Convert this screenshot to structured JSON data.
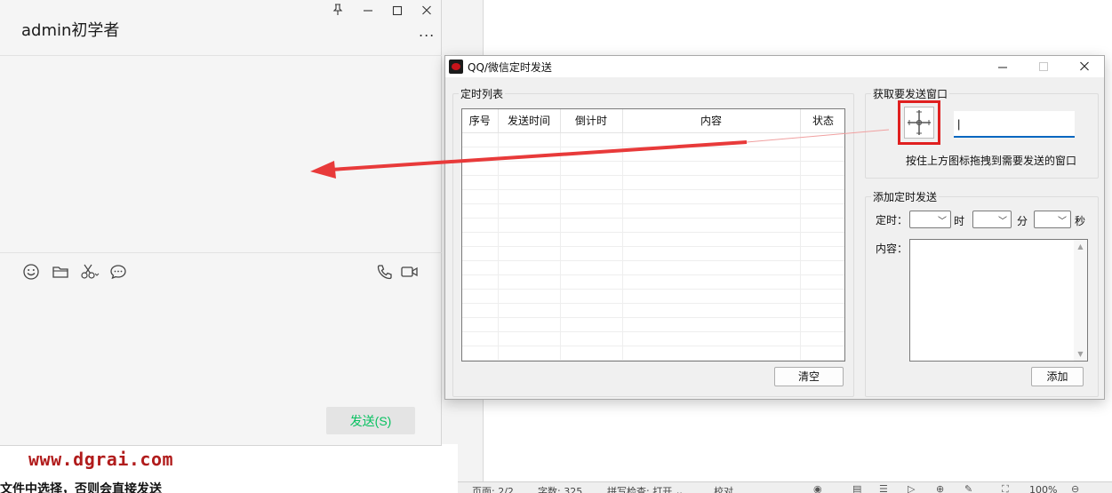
{
  "chat": {
    "title": "admin初学者",
    "more": "...",
    "send_label": "发送(S)"
  },
  "colors": {
    "wechat_green": "#07c160",
    "highlight_red": "#e02020",
    "arrow_red": "#e83a3a",
    "focus_blue": "#0067c0"
  },
  "icons": {
    "pin": "pin-icon",
    "minimize": "minimize-icon",
    "maximize": "maximize-icon",
    "close": "close-icon",
    "chat_tools": [
      "emoji-icon",
      "folder-icon",
      "scissors-icon",
      "chat-bubble-icon"
    ],
    "call_tools": [
      "phone-icon",
      "video-icon"
    ],
    "target": "crosshair-target-icon"
  },
  "dialog": {
    "title": "QQ/微信定时发送",
    "schedule": {
      "group_label": "定时列表",
      "columns": [
        "序号",
        "发送时间",
        "倒计时",
        "内容",
        "状态"
      ],
      "clear_label": "清空"
    },
    "target": {
      "group_label": "获取要发送窗口",
      "value": "|",
      "hint": "按住上方图标拖拽到需要发送的窗口"
    },
    "add": {
      "group_label": "添加定时发送",
      "time_label": "定时：",
      "hour_unit": "时",
      "minute_unit": "分",
      "second_unit": "秒",
      "content_label": "内容：",
      "add_label": "添加"
    }
  },
  "watermark": "www.dgrai.com",
  "doc_snippet": "文件中选择，否则会直接发送",
  "statusbar": {
    "page": "页面: 2/2",
    "words": "字数: 325",
    "spell": "拼写检查: 打开 ⌄",
    "proof": "校对",
    "zoom": "100%"
  }
}
